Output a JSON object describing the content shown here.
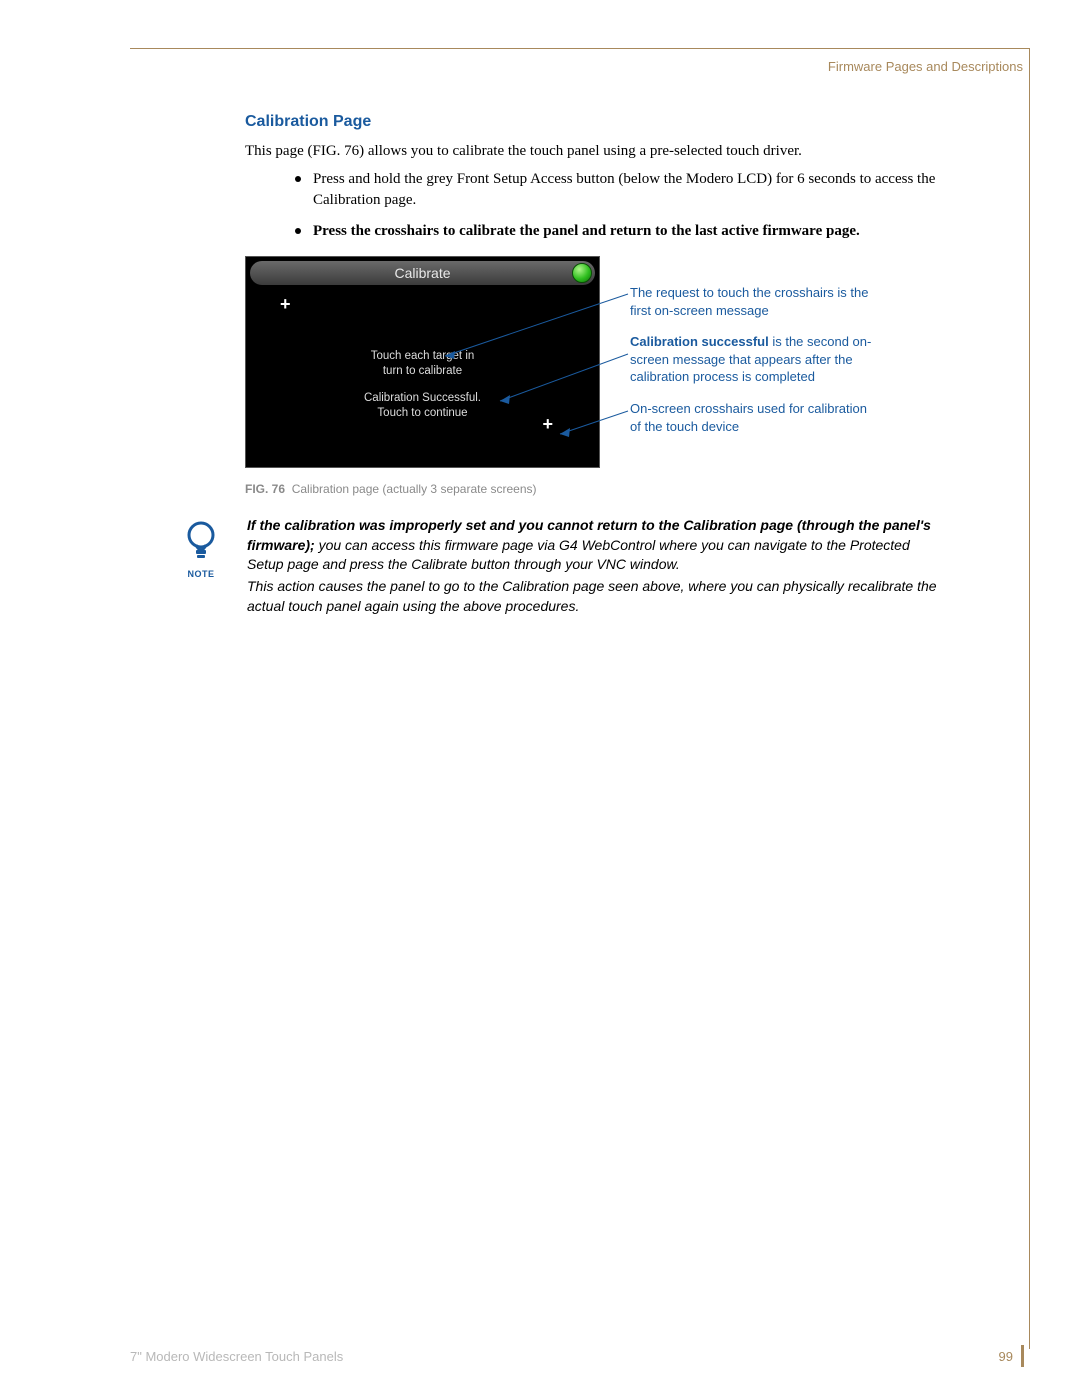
{
  "header": {
    "breadcrumb": "Firmware Pages and Descriptions"
  },
  "section": {
    "title": "Calibration Page",
    "intro": "This page (FIG. 76) allows you to calibrate the touch panel using a pre-selected touch driver.",
    "bullets": [
      {
        "text": "Press and hold the grey Front Setup Access button (below the Modero LCD) for 6 seconds to access the Calibration page.",
        "bold": false
      },
      {
        "text": "Press the crosshairs to calibrate the panel and return to the last active firmware page.",
        "bold": true
      }
    ]
  },
  "figure": {
    "screen_title": "Calibrate",
    "msg1_line1": "Touch each target in",
    "msg1_line2": "turn to calibrate",
    "msg2_line1": "Calibration Successful.",
    "msg2_line2": "Touch to continue",
    "caption_label": "FIG. 76",
    "caption_text": "Calibration page (actually 3 separate screens)"
  },
  "callouts": {
    "c1": "The request to touch the crosshairs is the first on-screen message",
    "c2_bold": "Calibration successful",
    "c2_rest": " is the second on-screen message that appears after the calibration process is completed",
    "c3": "On-screen crosshairs used for calibration of the touch device"
  },
  "note": {
    "label": "NOTE",
    "p1_bold": "If the calibration was improperly set and you cannot return to the Calibration page (through the panel's firmware);",
    "p1_rest": " you can access this firmware page via G4 WebControl where you can navigate to the Protected Setup page and press the Calibrate button through your VNC window.",
    "p2": "This action causes the panel to go to the Calibration page seen above, where you can physically recalibrate the actual touch panel again using the above procedures."
  },
  "footer": {
    "doc_title": "7\" Modero Widescreen Touch Panels",
    "page_number": "99"
  }
}
